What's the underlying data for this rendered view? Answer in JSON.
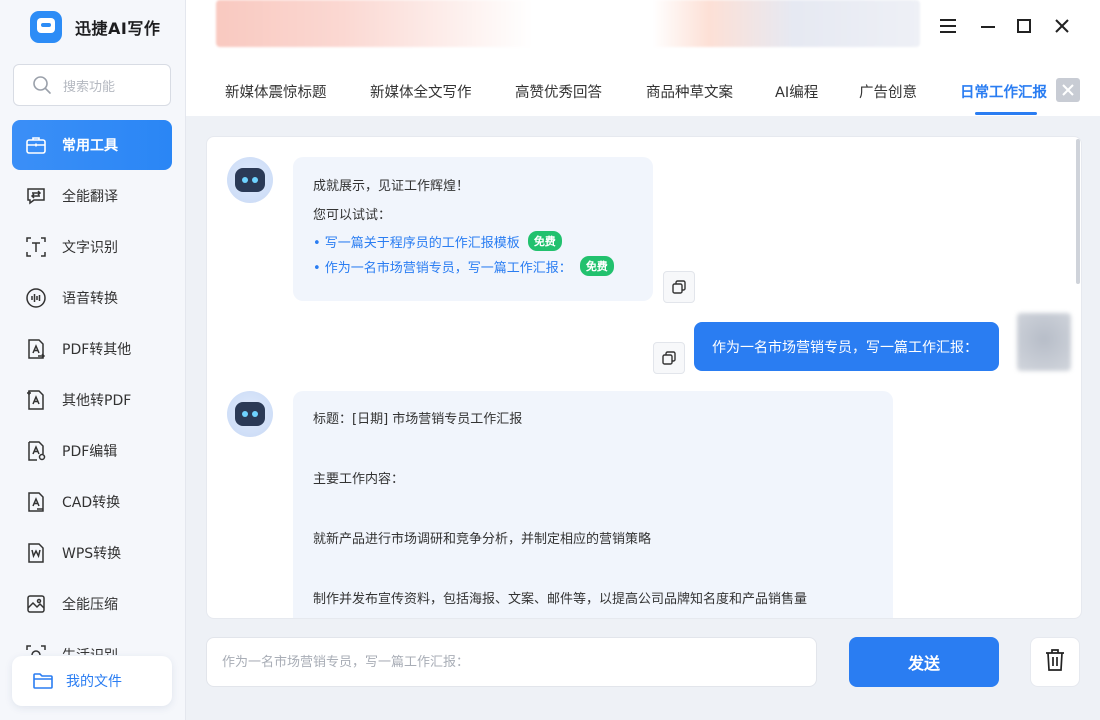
{
  "app": {
    "title": "迅捷AI写作"
  },
  "sidebar": {
    "search_placeholder": "搜索功能",
    "items": [
      {
        "label": "常用工具",
        "icon": "toolbox-icon",
        "active": true
      },
      {
        "label": "全能翻译",
        "icon": "translate-icon"
      },
      {
        "label": "文字识别",
        "icon": "text-recognition-icon"
      },
      {
        "label": "语音转换",
        "icon": "voice-convert-icon"
      },
      {
        "label": "PDF转其他",
        "icon": "pdf-convert-icon"
      },
      {
        "label": "其他转PDF",
        "icon": "to-pdf-icon"
      },
      {
        "label": "PDF编辑",
        "icon": "pdf-edit-icon"
      },
      {
        "label": "CAD转换",
        "icon": "cad-convert-icon"
      },
      {
        "label": "WPS转换",
        "icon": "wps-convert-icon"
      },
      {
        "label": "全能压缩",
        "icon": "compress-icon"
      },
      {
        "label": "生活识别",
        "icon": "life-recognition-icon"
      }
    ],
    "my_files": "我的文件"
  },
  "tabs": [
    {
      "label": "新媒体震惊标题"
    },
    {
      "label": "新媒体全文写作"
    },
    {
      "label": "高赞优秀回答"
    },
    {
      "label": "商品种草文案"
    },
    {
      "label": "AI编程"
    },
    {
      "label": "广告创意"
    },
    {
      "label": "日常工作汇报",
      "active": true
    }
  ],
  "chat": {
    "welcome": {
      "title": "成就展示，见证工作辉煌！",
      "hint": "您可以试试：",
      "suggestions": [
        {
          "text": "• 写一篇关于程序员的工作汇报模板",
          "tag": "免费"
        },
        {
          "text": "• 作为一名市场营销专员，写一篇工作汇报：",
          "tag": "免费"
        }
      ]
    },
    "user_message": "作为一名市场营销专员，写一篇工作汇报：",
    "reply": {
      "lines": [
        "标题：[日期] 市场营销专员工作汇报",
        "主要工作内容：",
        "就新产品进行市场调研和竞争分析，并制定相应的营销策略",
        "制作并发布宣传资料，包括海报、文案、邮件等，以提高公司品牌知名度和产品销售量"
      ]
    }
  },
  "composer": {
    "placeholder": "作为一名市场营销专员，写一篇工作汇报：",
    "send_label": "发送"
  },
  "colors": {
    "accent": "#2a7df2",
    "free_tag": "#22c16e"
  }
}
